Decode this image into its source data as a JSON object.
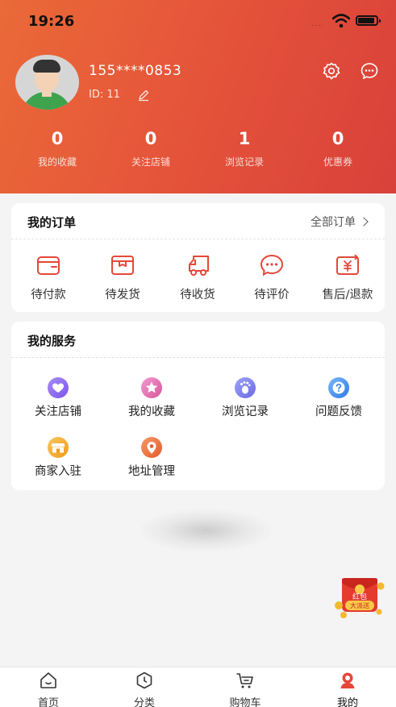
{
  "status_bar": {
    "time": "19:26",
    "signal": "...."
  },
  "profile": {
    "phone": "155****0853",
    "id_text": "ID: 11"
  },
  "stats": [
    {
      "value": "0",
      "label": "我的收藏"
    },
    {
      "value": "0",
      "label": "关注店铺"
    },
    {
      "value": "1",
      "label": "浏览记录"
    },
    {
      "value": "0",
      "label": "优惠券"
    }
  ],
  "orders": {
    "title": "我的订单",
    "all_label": "全部订单",
    "items": [
      {
        "label": "待付款",
        "icon": "wallet-icon"
      },
      {
        "label": "待发货",
        "icon": "package-icon"
      },
      {
        "label": "待收货",
        "icon": "truck-icon"
      },
      {
        "label": "待评价",
        "icon": "comment-icon"
      },
      {
        "label": "售后/退款",
        "icon": "refund-icon"
      }
    ]
  },
  "services": {
    "title": "我的服务",
    "items": [
      {
        "label": "关注店铺",
        "icon": "heart-icon",
        "color": "#8b6cf0"
      },
      {
        "label": "我的收藏",
        "icon": "star-icon",
        "color": "#ea6ab0"
      },
      {
        "label": "浏览记录",
        "icon": "footprint-icon",
        "color": "#7c7ff0"
      },
      {
        "label": "问题反馈",
        "icon": "question-icon",
        "color": "#3b8ff0"
      },
      {
        "label": "商家入驻",
        "icon": "shop-icon",
        "color": "#f5a623"
      },
      {
        "label": "地址管理",
        "icon": "location-icon",
        "color": "#ee6a3c"
      }
    ]
  },
  "promo": {
    "line1": "红包",
    "line2": "大派送"
  },
  "tabbar": [
    {
      "label": "首页",
      "icon": "home-icon"
    },
    {
      "label": "分类",
      "icon": "category-icon"
    },
    {
      "label": "购物车",
      "icon": "cart-icon"
    },
    {
      "label": "我的",
      "icon": "profile-icon",
      "active": true
    }
  ],
  "colors": {
    "header_start": "#ea6a38",
    "header_end": "#d8413a",
    "accent": "#e4473a"
  }
}
